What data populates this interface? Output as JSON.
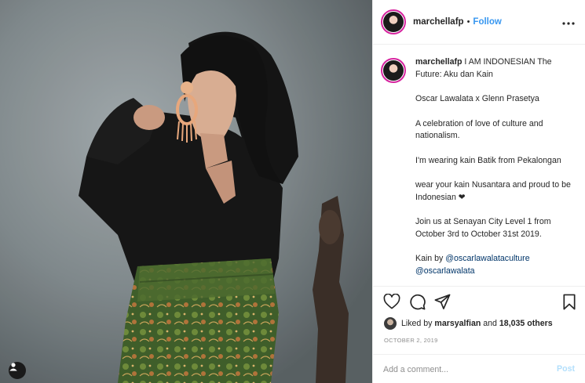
{
  "post": {
    "username": "marchellafp",
    "separator": "•",
    "follow_label": "Follow",
    "more_label": "•••"
  },
  "caption": {
    "username": "marchellafp",
    "line1": "I AM INDONESIAN The Future: Aku dan Kain",
    "para2": "Oscar Lawalata x Glenn Prasetya",
    "para3": "A celebration of love of culture and nationalism.",
    "para4": "I'm wearing kain Batik from Pekalongan",
    "para5": "wear your kain Nusantara and proud to be Indonesian ❤",
    "para6": "Join us at Senayan City Level 1 from October 3rd to October 31st 2019.",
    "para7_prefix": "Kain by ",
    "mention1": "@oscarlawalataculture",
    "mention2": "@oscarlawalata"
  },
  "actions": {
    "like_icon": "heart-outline-icon",
    "comment_icon": "comment-bubble-icon",
    "share_icon": "paper-plane-icon",
    "save_icon": "bookmark-icon"
  },
  "likes": {
    "prefix": "Liked by ",
    "user": "marsyalfian",
    "middle": " and ",
    "count": "18,035 others"
  },
  "date": "OCTOBER 2, 2019",
  "comment": {
    "placeholder": "Add a comment...",
    "post_label": "Post"
  },
  "colors": {
    "link_blue": "#3897f0",
    "post_disabled": "#b2dffc",
    "mention": "#003569",
    "border": "#efefef"
  }
}
